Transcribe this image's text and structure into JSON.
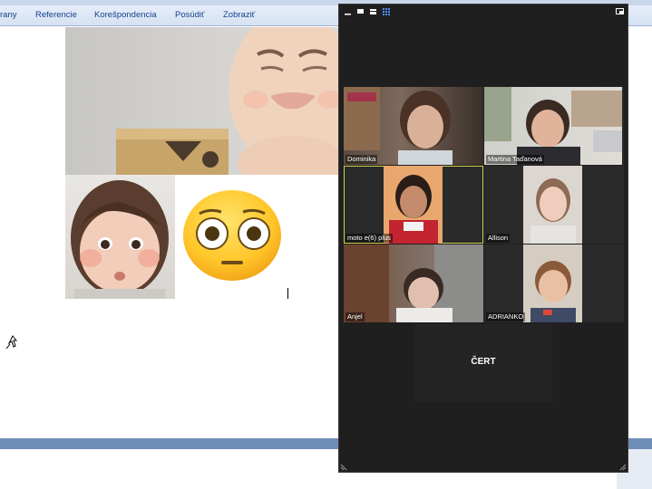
{
  "word": {
    "ribbon_tabs": [
      {
        "label": "rany"
      },
      {
        "label": "Referencie"
      },
      {
        "label": "Korešpondencia"
      },
      {
        "label": "Posúdiť"
      },
      {
        "label": "Zobraziť"
      }
    ]
  },
  "zoom": {
    "participants": [
      {
        "name": "Dominika"
      },
      {
        "name": "Martina Taďanová"
      },
      {
        "name": "moto e(6) plus"
      },
      {
        "name": "Allison"
      },
      {
        "name": "Anjel"
      },
      {
        "name": "ADRIANKO"
      }
    ],
    "no_video_participant": {
      "name": "ČERT"
    }
  },
  "icons": {
    "emoji": "flushed-face-emoji",
    "cursor": "mouse-pointer-icon"
  },
  "colors": {
    "zoom_background": "#1f1f1f",
    "active_speaker_border": "#cdd04a",
    "ribbon_text": "#15428b"
  }
}
